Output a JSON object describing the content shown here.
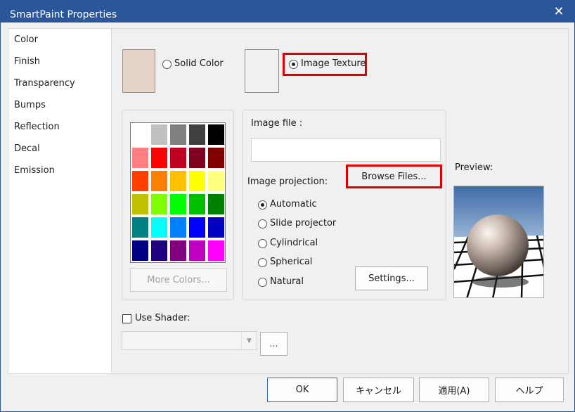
{
  "window": {
    "title": "SmartPaint Properties",
    "close_glyph": "✕"
  },
  "sidebar": {
    "items": [
      {
        "label": "Color"
      },
      {
        "label": "Finish"
      },
      {
        "label": "Transparency"
      },
      {
        "label": "Bumps"
      },
      {
        "label": "Reflection"
      },
      {
        "label": "Decal"
      },
      {
        "label": "Emission"
      }
    ]
  },
  "mode": {
    "solid_label": "Solid Color",
    "texture_label": "Image Texture",
    "selected": "Image Texture",
    "solid_swatch_color": "#e6d3c7"
  },
  "palette": {
    "colors": [
      [
        "#ffffff",
        "#c0c0c0",
        "#808080",
        "#404040",
        "#000000"
      ],
      [
        "#ff8080",
        "#ff0000",
        "#c00020",
        "#800020",
        "#800000"
      ],
      [
        "#ff4000",
        "#ff8000",
        "#ffc000",
        "#ffff00",
        "#ffff80"
      ],
      [
        "#c0c000",
        "#80ff00",
        "#00ff00",
        "#00c000",
        "#008000"
      ],
      [
        "#008080",
        "#00ffff",
        "#0080ff",
        "#0000ff",
        "#0000c0"
      ],
      [
        "#000080",
        "#200080",
        "#800080",
        "#c000c0",
        "#ff00ff"
      ]
    ],
    "more_colors_label": "More Colors..."
  },
  "texture": {
    "image_file_label": "Image file :",
    "image_file_value": "",
    "browse_label": "Browse Files...",
    "projection_label": "Image projection:",
    "projections": [
      {
        "label": "Automatic",
        "selected": true
      },
      {
        "label": "Slide projector",
        "selected": false
      },
      {
        "label": "Cylindrical",
        "selected": false
      },
      {
        "label": "Spherical",
        "selected": false
      },
      {
        "label": "Natural",
        "selected": false
      }
    ],
    "settings_label": "Settings..."
  },
  "preview": {
    "label": "Preview:"
  },
  "shader": {
    "label": "Use Shader:",
    "checked": false,
    "combo_value": "",
    "ellipsis_label": "..."
  },
  "footer": {
    "ok": "OK",
    "cancel": "キャンセル",
    "apply": "適用(A)",
    "help": "ヘルプ"
  },
  "colors": {
    "titlebar": "#2b579a",
    "highlight": "#e00000"
  }
}
